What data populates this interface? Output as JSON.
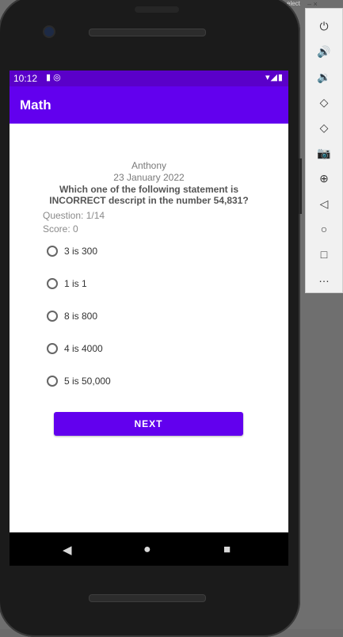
{
  "status_bar": {
    "time": "10:12",
    "left_icons": "▮ ◎",
    "right_icons": "▾◢▮"
  },
  "app_bar": {
    "title": "Math"
  },
  "quiz": {
    "user_name": "Anthony",
    "date": "23 January 2022",
    "question": "Which one of the following statement is INCORRECT descript in the number 54,831?",
    "question_count": "Question: 1/14",
    "score": "Score: 0",
    "options": [
      "3 is 300",
      "1 is 1",
      "8 is 800",
      "4 is 4000",
      "5 is 50,000"
    ],
    "next_label": "NEXT"
  },
  "nav_bar": {
    "back": "◀",
    "home": "●",
    "recents": "■"
  },
  "emulator_panel": {
    "window_controls": "–  ×",
    "select_text": "elect",
    "tools": [
      "⏻",
      "🔊",
      "🔉",
      "◇",
      "◇",
      "📷",
      "⊕",
      "◁",
      "○",
      "□",
      "…"
    ]
  }
}
